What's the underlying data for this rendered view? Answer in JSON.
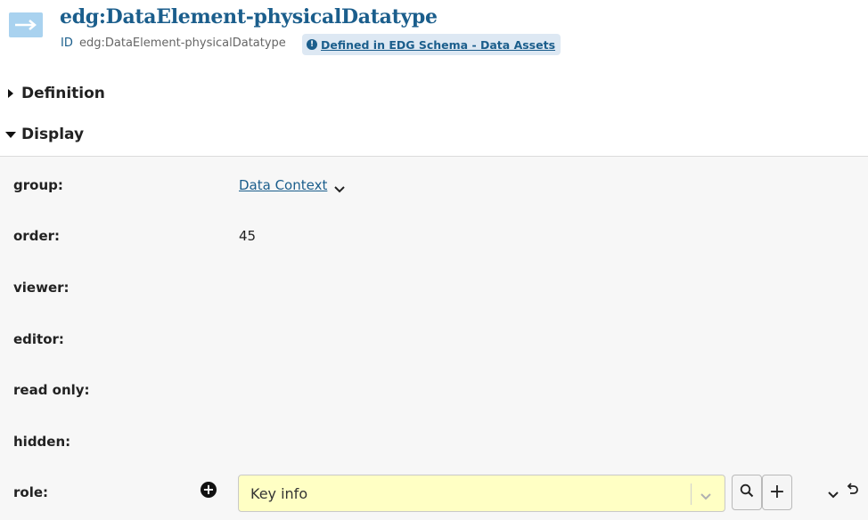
{
  "header": {
    "title": "edg:DataElement-physicalDatatype",
    "id_label": "ID",
    "id_value": "edg:DataElement-physicalDatatype",
    "defined_in": "Defined in EDG Schema - Data Assets",
    "type_icon": "arrow-right-icon",
    "colors": {
      "accent": "#1b5e8c",
      "badge_bg": "#dde8f3",
      "icon_bg": "#a9d2ef"
    }
  },
  "sections": {
    "definition": {
      "label": "Definition",
      "expanded": false
    },
    "display": {
      "label": "Display",
      "expanded": true
    }
  },
  "display": {
    "group": {
      "label": "group:",
      "value": "Data Context"
    },
    "order": {
      "label": "order:",
      "value": "45"
    },
    "viewer": {
      "label": "viewer:"
    },
    "editor": {
      "label": "editor:"
    },
    "read_only": {
      "label": "read only:"
    },
    "hidden": {
      "label": "hidden:"
    },
    "role": {
      "label": "role:",
      "selected": "Key info",
      "field_bg": "#ffffc4"
    }
  }
}
